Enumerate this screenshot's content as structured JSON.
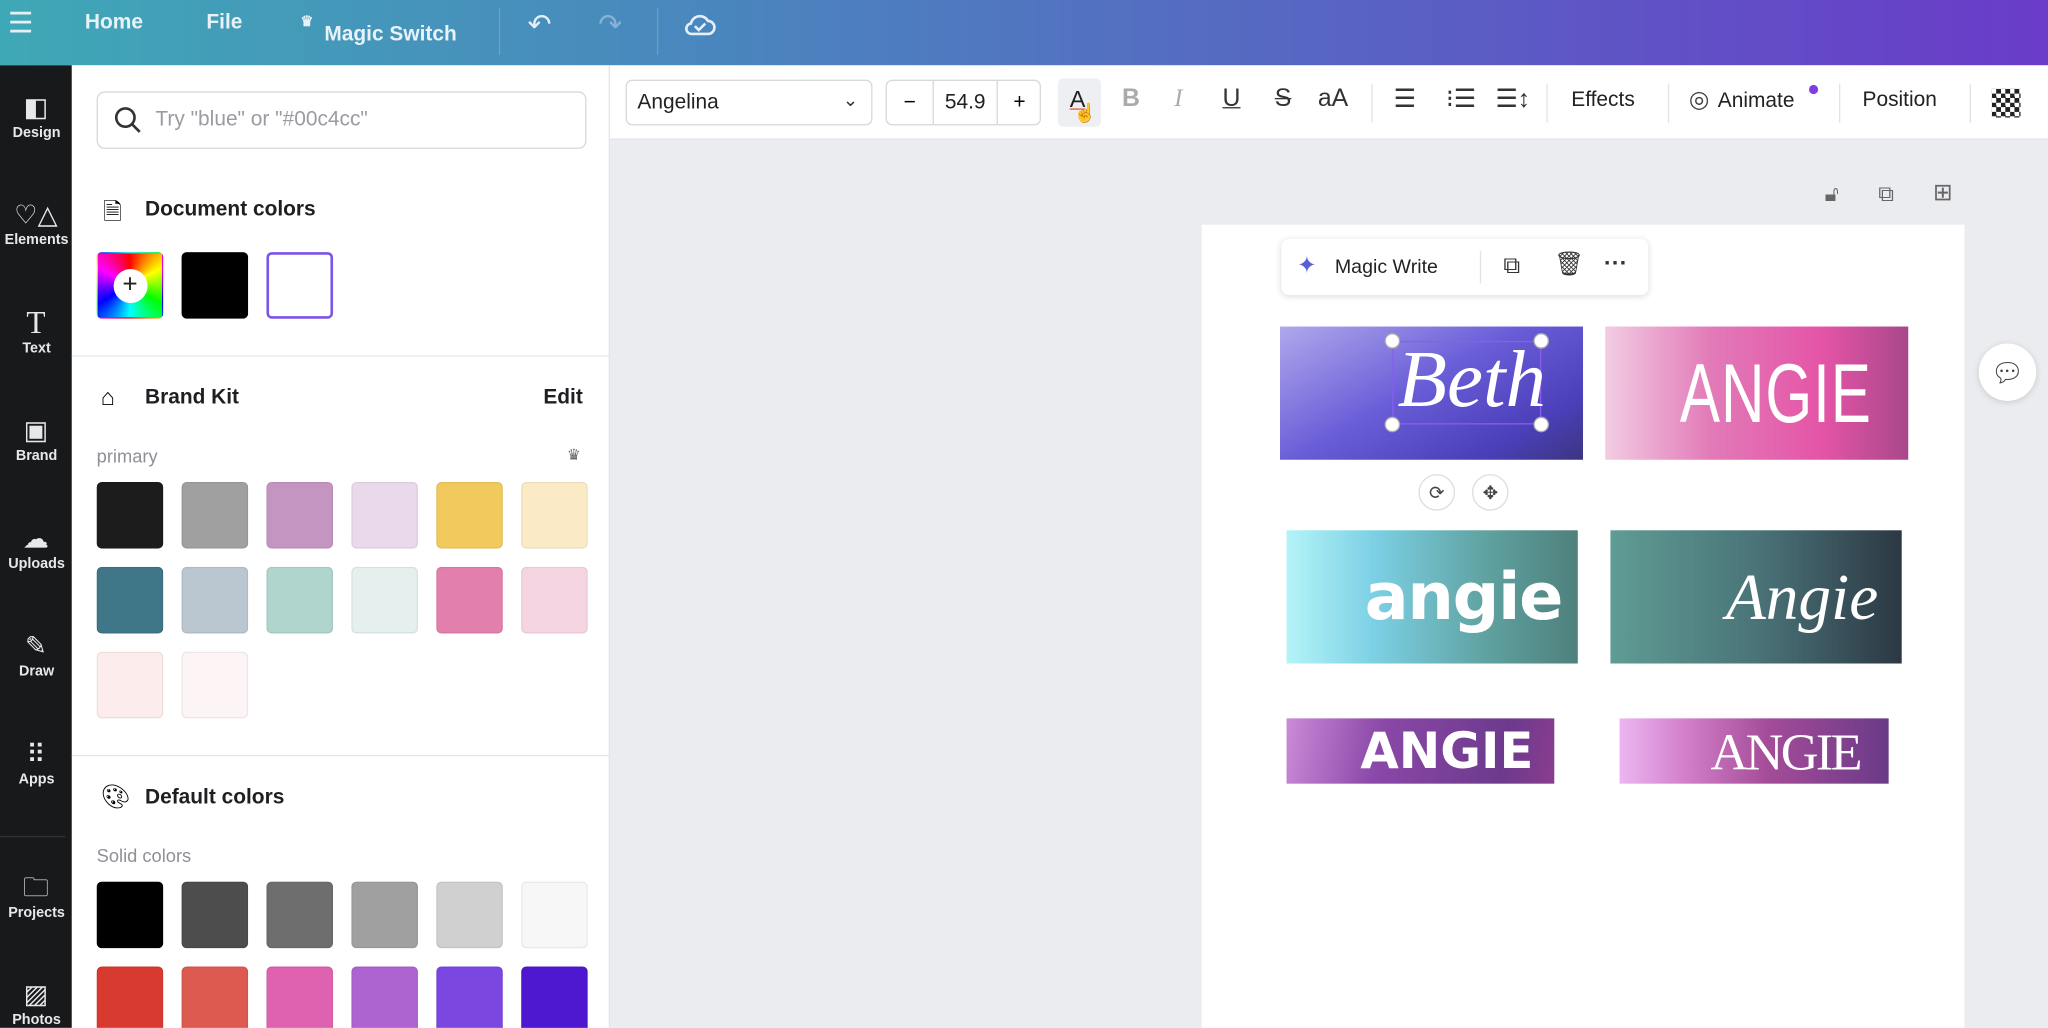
{
  "header": {
    "menu_icon": "hamburger-icon",
    "home": "Home",
    "file": "File",
    "magic_switch": "Magic Switch",
    "magic_icon": "crown-icon",
    "undo_icon": "undo-icon",
    "redo_icon": "redo-icon",
    "cloud_icon": "cloud-check-icon"
  },
  "rail": {
    "items": [
      {
        "label": "Design",
        "icon": "layout-icon"
      },
      {
        "label": "Elements",
        "icon": "shapes-icon"
      },
      {
        "label": "Text",
        "icon": "text-icon"
      },
      {
        "label": "Brand",
        "icon": "brand-icon"
      },
      {
        "label": "Uploads",
        "icon": "cloud-upload-icon"
      },
      {
        "label": "Draw",
        "icon": "pen-icon"
      },
      {
        "label": "Apps",
        "icon": "grid-icon"
      },
      {
        "label": "Projects",
        "icon": "folder-icon"
      },
      {
        "label": "Photos",
        "icon": "image-icon"
      }
    ]
  },
  "panel": {
    "search_placeholder": "Try \"blue\" or \"#00c4cc\"",
    "document_colors": {
      "title": "Document colors",
      "swatches": [
        "#000000",
        "#ffffff"
      ],
      "selected": "#ffffff"
    },
    "brand_kit": {
      "title": "Brand Kit",
      "edit": "Edit",
      "palette_name": "primary",
      "swatches": [
        "#1c1c1c",
        "#a0a0a0",
        "#c595c2",
        "#ead9ea",
        "#f2c95c",
        "#fbeac6",
        "#3f7688",
        "#bac6d0",
        "#b0d5cc",
        "#e4efee",
        "#e27fac",
        "#f6d5e2",
        "#fcecec",
        "#fdf5f5"
      ]
    },
    "default_colors": {
      "title": "Default colors",
      "subtitle": "Solid colors",
      "swatches": [
        "#000000",
        "#4d4d4d",
        "#6e6e6e",
        "#a0a0a0",
        "#d0d0d0",
        "#f7f7f7",
        "#d93a30",
        "#dc5a50",
        "#de62b0",
        "#ae64d0",
        "#7a48e0",
        "#4e18d0"
      ]
    }
  },
  "toolbar": {
    "font": "Angelina",
    "font_size": "54.9",
    "minus": "−",
    "plus": "+",
    "effects": "Effects",
    "animate": "Animate",
    "position": "Position",
    "accent": "#7b3fe4"
  },
  "canvas": {
    "float_toolbar": {
      "magic_write": "Magic Write"
    },
    "cards": [
      {
        "text": "Beth",
        "selected": true
      },
      {
        "text": "ANGIE"
      },
      {
        "text": "angie"
      },
      {
        "text": "Angie"
      },
      {
        "text": "ANGIE"
      },
      {
        "text": "ANGIE"
      }
    ]
  }
}
